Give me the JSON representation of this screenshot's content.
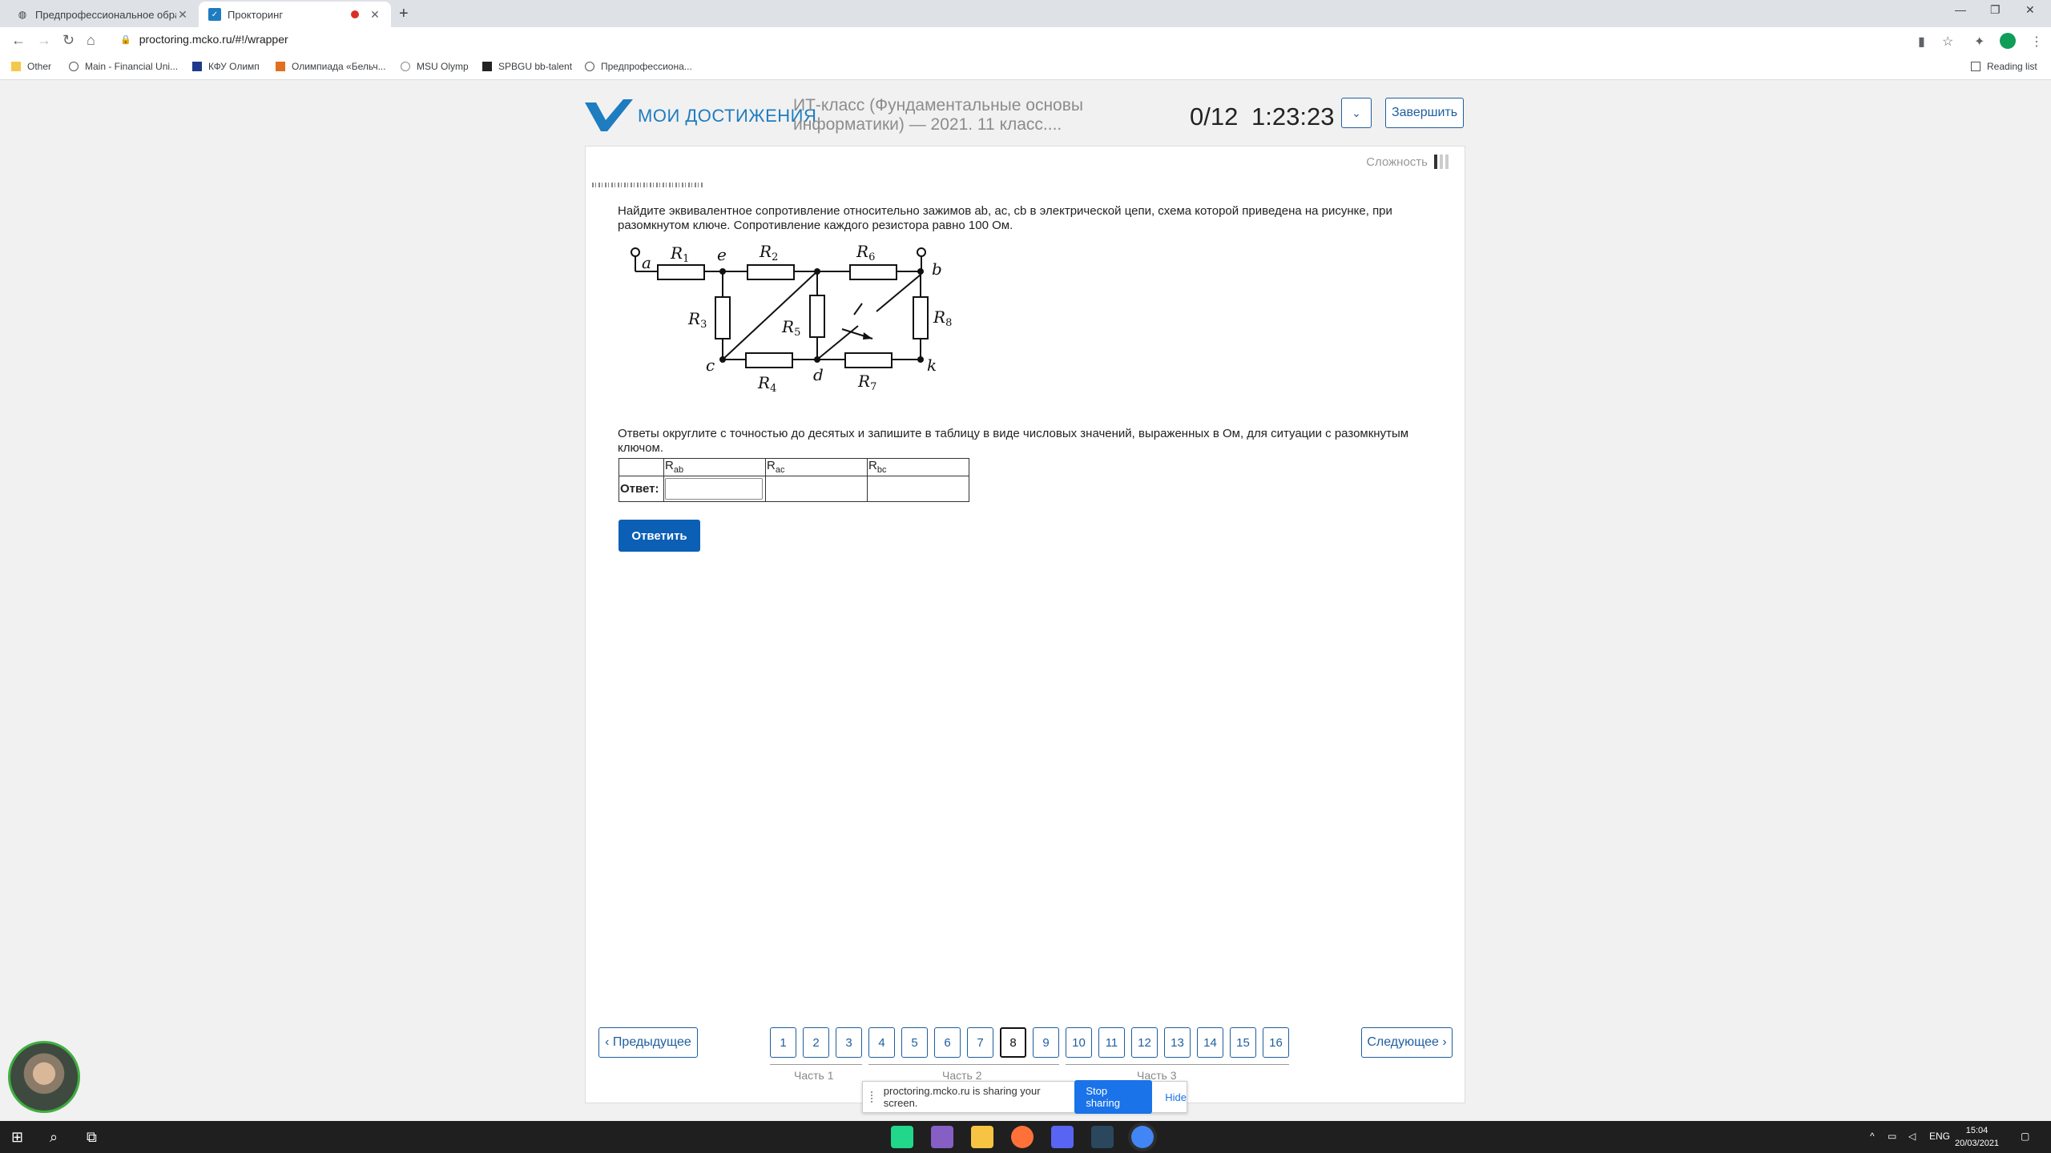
{
  "browser": {
    "tabs": [
      {
        "title": "Предпрофессиональное образ"
      },
      {
        "title": "Прокторинг"
      }
    ],
    "url": "proctoring.mcko.ru/#!/wrapper",
    "reading_list": "Reading list",
    "bookmarks": [
      "Other",
      "Main - Financial Uni...",
      "КФУ Олимп",
      "Олимпиада «Бельч...",
      "MSU Olymp",
      "SPBGU bb-talent",
      "Предпрофессиона..."
    ]
  },
  "header": {
    "logo_text": "МОИ ДОСТИЖЕНИЯ",
    "course_title": "ИТ-класс (Фундаментальные основы информатики) — 2021. 11 класс....",
    "counter": "0/12",
    "timer": "1:23:23",
    "finish_label": "Завершить"
  },
  "task": {
    "difficulty_label": "Сложность",
    "difficulty_level": 1,
    "difficulty_max": 3,
    "question_text": "Найдите эквивалентное сопротивление относительно зажимов ab, ac, cb в электрической цепи, схема которой приведена на рисунке, при разомкнутом ключе. Сопротивление каждого резистора равно 100 Ом.",
    "answer_intro": "Ответы округлите с точностью до десятых и запишите в таблицу в виде числовых значений, выраженных в Ом, для ситуации с разомкнутым ключом.",
    "answer_row_label": "Ответ:",
    "columns": [
      {
        "base": "R",
        "sub": "ab"
      },
      {
        "base": "R",
        "sub": "ac"
      },
      {
        "base": "R",
        "sub": "bc"
      }
    ],
    "submit_label": "Ответить"
  },
  "circuit": {
    "nodes": [
      "a",
      "e",
      "b",
      "c",
      "d",
      "k"
    ],
    "resistors": [
      "R1",
      "R2",
      "R6",
      "R3",
      "R5",
      "R8",
      "R4",
      "R7"
    ]
  },
  "pager": {
    "prev_label": "‹ Предыдущее",
    "next_label": "Следующее ›",
    "pages": [
      "1",
      "2",
      "3",
      "4",
      "5",
      "6",
      "7",
      "8",
      "9",
      "10",
      "11",
      "12",
      "13",
      "14",
      "15",
      "16"
    ],
    "current": "8",
    "parts": [
      "Часть 1",
      "Часть 2",
      "Часть 3"
    ]
  },
  "share_bar": {
    "message": "proctoring.mcko.ru is sharing your screen.",
    "stop_label": "Stop sharing",
    "hide_label": "Hide"
  },
  "taskbar": {
    "lang": "ENG",
    "time": "15:04",
    "date": "20/03/2021"
  },
  "colors": {
    "brand": "#1e7cc0",
    "button": "#0b5fb5",
    "border": "#1e5e9e"
  }
}
